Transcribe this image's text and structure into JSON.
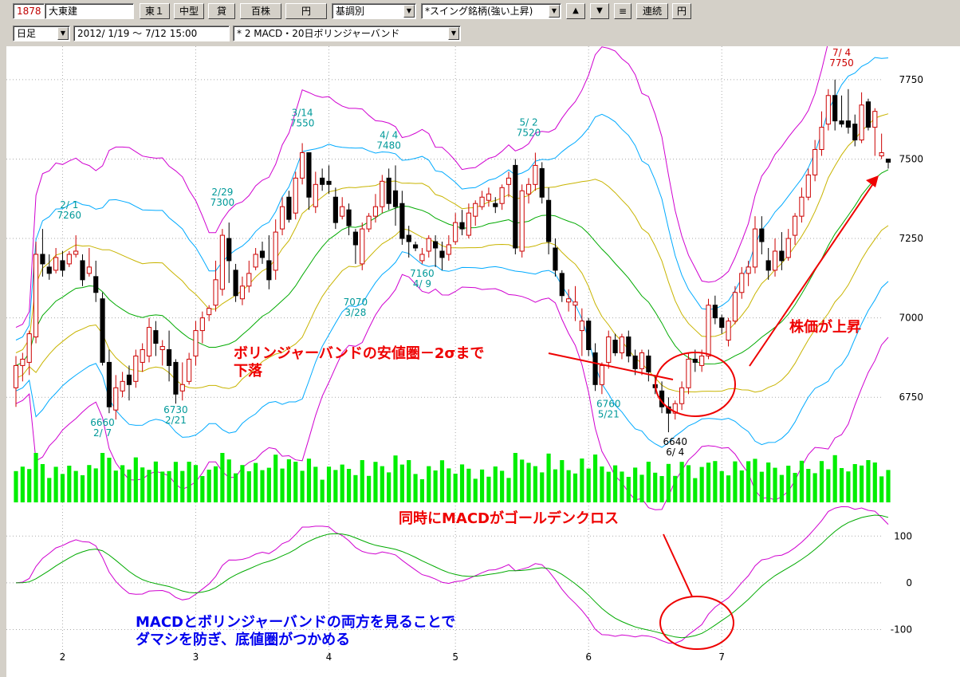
{
  "toolbar": {
    "code": "1878",
    "name": "大東建",
    "market": "東１",
    "size": "中型",
    "lending": "貸",
    "unit": "百株",
    "currency": "円",
    "mode": "基調別",
    "screen": "*スイング銘柄(強い上昇)",
    "up_icon": "up-triangle",
    "down_icon": "down-triangle",
    "menu_label": "≡",
    "link_label": "連続",
    "yen_label": "円",
    "period": "日足",
    "range": "2012/ 1/19 ～ 7/12 15:00",
    "indicator": "* 2 MACD・20日ボリンジャーバンド"
  },
  "colors": {
    "up": "#cc0000",
    "down": "#000000",
    "volume": "#00ee00",
    "sma": "#00aa00",
    "sigma1": "#c8b400",
    "sigma2": "#00aaff",
    "sigma3": "#d000d0",
    "annot": "#ee0000",
    "note": "#0000ee",
    "hilo": "#009999"
  },
  "chart_data": {
    "type": "candlestick",
    "price_ylim": [
      6600,
      7850
    ],
    "price_ticks": [
      7750,
      7500,
      7250,
      7000,
      6750
    ],
    "macd_ticks": [
      100,
      0,
      -100
    ],
    "month_labels": [
      {
        "label": "2",
        "idx": 7
      },
      {
        "label": "3",
        "idx": 27
      },
      {
        "label": "4",
        "idx": 47
      },
      {
        "label": "5",
        "idx": 66
      },
      {
        "label": "6",
        "idx": 86
      },
      {
        "label": "7",
        "idx": 106
      }
    ],
    "ohlc": [
      [
        6780,
        6880,
        6720,
        6850
      ],
      [
        6850,
        6890,
        6800,
        6870
      ],
      [
        6860,
        6960,
        6820,
        6950
      ],
      [
        6940,
        7240,
        6920,
        7200
      ],
      [
        7200,
        7280,
        7130,
        7170
      ],
      [
        7160,
        7200,
        7120,
        7140
      ],
      [
        7150,
        7220,
        7140,
        7190
      ],
      [
        7180,
        7210,
        7130,
        7150
      ],
      [
        7170,
        7210,
        7160,
        7200
      ],
      [
        7200,
        7260,
        7190,
        7210
      ],
      [
        7180,
        7200,
        7100,
        7120
      ],
      [
        7140,
        7220,
        7130,
        7160
      ],
      [
        7130,
        7180,
        7050,
        7080
      ],
      [
        7060,
        7080,
        6850,
        6860
      ],
      [
        6860,
        6900,
        6700,
        6720
      ],
      [
        6710,
        6820,
        6680,
        6780
      ],
      [
        6770,
        6830,
        6750,
        6800
      ],
      [
        6820,
        6850,
        6740,
        6790
      ],
      [
        6800,
        6900,
        6780,
        6880
      ],
      [
        6860,
        6920,
        6830,
        6900
      ],
      [
        6880,
        7000,
        6860,
        6970
      ],
      [
        6960,
        6990,
        6880,
        6920
      ],
      [
        6900,
        6930,
        6850,
        6910
      ],
      [
        6900,
        6960,
        6800,
        6850
      ],
      [
        6860,
        6870,
        6730,
        6760
      ],
      [
        6770,
        6860,
        6740,
        6790
      ],
      [
        6800,
        6890,
        6790,
        6870
      ],
      [
        6880,
        6990,
        6850,
        6960
      ],
      [
        6960,
        7020,
        6920,
        7000
      ],
      [
        7010,
        7040,
        6990,
        7030
      ],
      [
        7040,
        7180,
        7020,
        7120
      ],
      [
        7090,
        7280,
        7070,
        7260
      ],
      [
        7250,
        7300,
        7110,
        7180
      ],
      [
        7150,
        7170,
        7050,
        7070
      ],
      [
        7060,
        7130,
        7040,
        7100
      ],
      [
        7100,
        7180,
        7080,
        7140
      ],
      [
        7160,
        7220,
        7150,
        7200
      ],
      [
        7210,
        7240,
        7170,
        7190
      ],
      [
        7180,
        7260,
        7090,
        7120
      ],
      [
        7150,
        7310,
        7120,
        7270
      ],
      [
        7280,
        7380,
        7260,
        7350
      ],
      [
        7380,
        7400,
        7300,
        7310
      ],
      [
        7330,
        7460,
        7310,
        7440
      ],
      [
        7440,
        7550,
        7420,
        7520
      ],
      [
        7520,
        7480,
        7340,
        7380
      ],
      [
        7350,
        7460,
        7330,
        7420
      ],
      [
        7440,
        7470,
        7400,
        7420
      ],
      [
        7430,
        7480,
        7390,
        7420
      ],
      [
        7380,
        7410,
        7280,
        7300
      ],
      [
        7320,
        7380,
        7310,
        7350
      ],
      [
        7340,
        7360,
        7260,
        7290
      ],
      [
        7270,
        7280,
        7170,
        7230
      ],
      [
        7170,
        7300,
        7150,
        7280
      ],
      [
        7280,
        7330,
        7270,
        7320
      ],
      [
        7320,
        7390,
        7300,
        7350
      ],
      [
        7350,
        7450,
        7330,
        7430
      ],
      [
        7440,
        7470,
        7340,
        7360
      ],
      [
        7400,
        7480,
        7290,
        7350
      ],
      [
        7360,
        7400,
        7230,
        7250
      ],
      [
        7260,
        7290,
        7190,
        7240
      ],
      [
        7230,
        7240,
        7210,
        7220
      ],
      [
        7180,
        7220,
        7170,
        7200
      ],
      [
        7210,
        7260,
        7190,
        7250
      ],
      [
        7240,
        7260,
        7160,
        7220
      ],
      [
        7210,
        7240,
        7150,
        7190
      ],
      [
        7200,
        7260,
        7180,
        7230
      ],
      [
        7240,
        7330,
        7230,
        7300
      ],
      [
        7300,
        7340,
        7260,
        7280
      ],
      [
        7260,
        7360,
        7250,
        7330
      ],
      [
        7320,
        7370,
        7290,
        7360
      ],
      [
        7350,
        7400,
        7340,
        7380
      ],
      [
        7370,
        7410,
        7350,
        7390
      ],
      [
        7360,
        7380,
        7330,
        7350
      ],
      [
        7360,
        7420,
        7340,
        7410
      ],
      [
        7420,
        7460,
        7380,
        7440
      ],
      [
        7480,
        7500,
        7200,
        7220
      ],
      [
        7210,
        7420,
        7190,
        7400
      ],
      [
        7390,
        7440,
        7360,
        7420
      ],
      [
        7420,
        7520,
        7400,
        7480
      ],
      [
        7470,
        7490,
        7360,
        7380
      ],
      [
        7370,
        7410,
        7200,
        7240
      ],
      [
        7220,
        7250,
        7130,
        7150
      ],
      [
        7140,
        7150,
        7050,
        7070
      ],
      [
        7050,
        7090,
        7020,
        7060
      ],
      [
        7040,
        7100,
        6990,
        7050
      ],
      [
        6960,
        7030,
        6880,
        6990
      ],
      [
        6990,
        7000,
        6880,
        6900
      ],
      [
        6890,
        6920,
        6770,
        6790
      ],
      [
        6790,
        6860,
        6760,
        6850
      ],
      [
        6860,
        6960,
        6840,
        6940
      ],
      [
        6930,
        6950,
        6880,
        6890
      ],
      [
        6890,
        6950,
        6870,
        6940
      ],
      [
        6940,
        6960,
        6860,
        6880
      ],
      [
        6880,
        6900,
        6820,
        6840
      ],
      [
        6840,
        6900,
        6820,
        6890
      ],
      [
        6880,
        6900,
        6800,
        6830
      ],
      [
        6790,
        6820,
        6760,
        6780
      ],
      [
        6770,
        6800,
        6700,
        6720
      ],
      [
        6720,
        6750,
        6640,
        6700
      ],
      [
        6700,
        6740,
        6680,
        6730
      ],
      [
        6730,
        6800,
        6710,
        6780
      ],
      [
        6780,
        6890,
        6760,
        6870
      ],
      [
        6870,
        6900,
        6830,
        6860
      ],
      [
        6850,
        6900,
        6830,
        6880
      ],
      [
        6880,
        7060,
        6870,
        7040
      ],
      [
        7040,
        7070,
        6980,
        7000
      ],
      [
        7000,
        7010,
        6950,
        6970
      ],
      [
        6930,
        7000,
        6910,
        6990
      ],
      [
        6990,
        7100,
        6980,
        7080
      ],
      [
        7080,
        7160,
        7060,
        7140
      ],
      [
        7140,
        7180,
        7100,
        7160
      ],
      [
        7160,
        7320,
        7140,
        7280
      ],
      [
        7280,
        7320,
        7200,
        7240
      ],
      [
        7180,
        7220,
        7120,
        7150
      ],
      [
        7150,
        7250,
        7130,
        7210
      ],
      [
        7210,
        7270,
        7150,
        7180
      ],
      [
        7190,
        7280,
        7180,
        7250
      ],
      [
        7260,
        7330,
        7230,
        7320
      ],
      [
        7320,
        7410,
        7300,
        7380
      ],
      [
        7380,
        7470,
        7370,
        7450
      ],
      [
        7450,
        7560,
        7430,
        7530
      ],
      [
        7530,
        7650,
        7510,
        7600
      ],
      [
        7610,
        7720,
        7590,
        7700
      ],
      [
        7700,
        7750,
        7590,
        7620
      ],
      [
        7620,
        7700,
        7600,
        7610
      ],
      [
        7620,
        7720,
        7580,
        7600
      ],
      [
        7610,
        7640,
        7540,
        7560
      ],
      [
        7560,
        7710,
        7550,
        7670
      ],
      [
        7680,
        7690,
        7590,
        7600
      ],
      [
        7600,
        7660,
        7510,
        7650
      ],
      [
        7510,
        7580,
        7500,
        7520
      ],
      [
        7500,
        7500,
        7470,
        7490
      ]
    ],
    "price_labels": [
      {
        "text": "2/ 1",
        "idx": 8,
        "price": 7280,
        "pos": "above"
      },
      {
        "text": "7260",
        "idx": 8,
        "price": 7280,
        "pos": "above2"
      },
      {
        "text": "6660",
        "idx": 13,
        "price": 6700,
        "pos": "below"
      },
      {
        "text": "2/ 7",
        "idx": 13,
        "price": 6700,
        "pos": "below2"
      },
      {
        "text": "6730",
        "idx": 24,
        "price": 6740,
        "pos": "below"
      },
      {
        "text": "2/21",
        "idx": 24,
        "price": 6740,
        "pos": "below2"
      },
      {
        "text": "2/29",
        "idx": 31,
        "price": 7320,
        "pos": "above"
      },
      {
        "text": "7300",
        "idx": 31,
        "price": 7320,
        "pos": "above2"
      },
      {
        "text": "3/14",
        "idx": 43,
        "price": 7570,
        "pos": "above"
      },
      {
        "text": "7550",
        "idx": 43,
        "price": 7570,
        "pos": "above2"
      },
      {
        "text": "7070",
        "idx": 51,
        "price": 7080,
        "pos": "below"
      },
      {
        "text": "3/28",
        "idx": 51,
        "price": 7080,
        "pos": "below2"
      },
      {
        "text": "4/ 4",
        "idx": 56,
        "price": 7500,
        "pos": "above"
      },
      {
        "text": "7480",
        "idx": 56,
        "price": 7500,
        "pos": "above2"
      },
      {
        "text": "7160",
        "idx": 61,
        "price": 7170,
        "pos": "below"
      },
      {
        "text": "4/ 9",
        "idx": 61,
        "price": 7170,
        "pos": "below2"
      },
      {
        "text": "5/ 2",
        "idx": 77,
        "price": 7540,
        "pos": "above"
      },
      {
        "text": "7520",
        "idx": 77,
        "price": 7540,
        "pos": "above2"
      },
      {
        "text": "6760",
        "idx": 89,
        "price": 6760,
        "pos": "below"
      },
      {
        "text": "5/21",
        "idx": 89,
        "price": 6760,
        "pos": "below2"
      },
      {
        "text": "6640",
        "idx": 99,
        "price": 6640,
        "pos": "below",
        "color": "black"
      },
      {
        "text": "6/ 4",
        "idx": 99,
        "price": 6640,
        "pos": "below2",
        "color": "black"
      },
      {
        "text": "7/ 4",
        "idx": 124,
        "price": 7760,
        "pos": "above",
        "color": "red"
      },
      {
        "text": "7750",
        "idx": 124,
        "price": 7760,
        "pos": "above2",
        "color": "red"
      }
    ],
    "annotations": {
      "bollinger_text1": "ボリンジャーバンドの安値圏－2σまで",
      "bollinger_text2": "下落",
      "price_up_text": "株価が上昇",
      "macd_cross_text": "同時にMACDがゴールデンクロス",
      "summary_text1": "MACDとボリンジャーバンドの両方を見ることで",
      "summary_text2": "ダマシを防ぎ、底値圏がつかめる"
    }
  }
}
